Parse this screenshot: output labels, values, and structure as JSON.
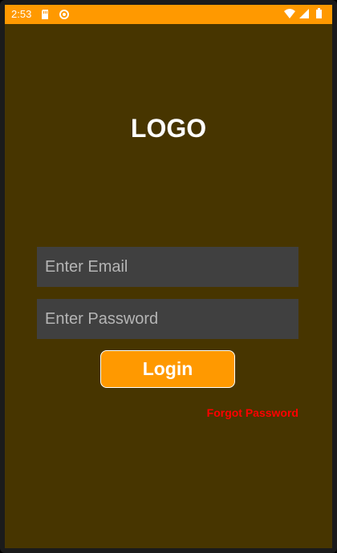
{
  "status_bar": {
    "time": "2:53",
    "icons_left": [
      "sd-card-icon",
      "sync-icon"
    ],
    "icons_right": [
      "wifi-icon",
      "signal-icon",
      "battery-icon"
    ],
    "color": "#ff9900"
  },
  "screen": {
    "background": "#473500",
    "logo_text": "LOGO"
  },
  "form": {
    "email_placeholder": "Enter Email",
    "password_placeholder": "Enter Password",
    "login_label": "Login",
    "forgot_label": "Forgot Password",
    "accent": "#ff9900",
    "link_color": "#ff0000"
  }
}
